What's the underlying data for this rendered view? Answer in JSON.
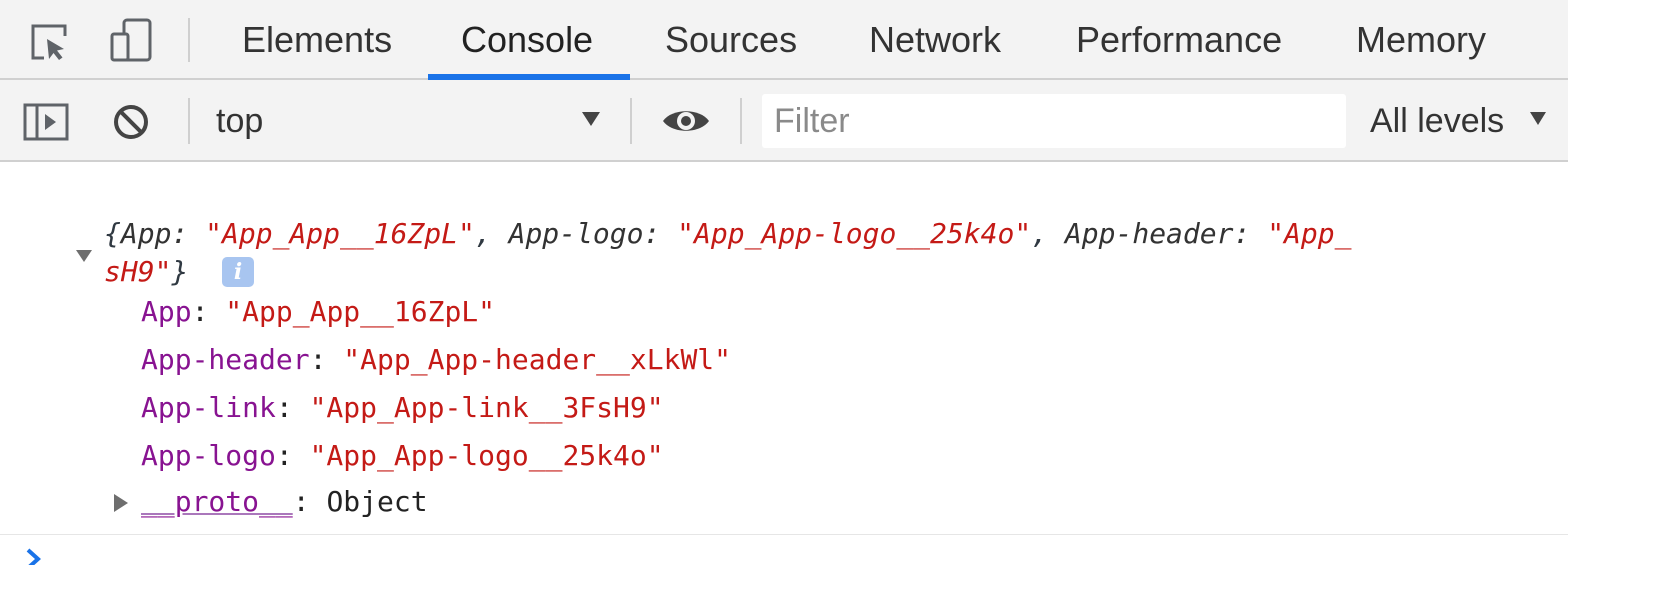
{
  "tabs": {
    "items": [
      {
        "label": "Elements"
      },
      {
        "label": "Console"
      },
      {
        "label": "Sources"
      },
      {
        "label": "Network"
      },
      {
        "label": "Performance"
      },
      {
        "label": "Memory"
      }
    ],
    "active": "Console"
  },
  "toolbar": {
    "context": "top",
    "filter_placeholder": "Filter",
    "levels_label": "All levels"
  },
  "console": {
    "summary": {
      "open_brace": "{",
      "k1": "App: ",
      "v1": "\"App_App__16ZpL\"",
      "sep1": ", ",
      "k2": "App-logo: ",
      "v2": "\"App_App-logo__25k4o\"",
      "sep2": ", ",
      "k3": "App-header: ",
      "v3_start": "\"App_",
      "v3_end": "sH9\"",
      "close_brace": "}",
      "info_label": "i"
    },
    "properties": [
      {
        "key": "App",
        "value": "\"App_App__16ZpL\""
      },
      {
        "key": "App-header",
        "value": "\"App_App-header__xLkWl\""
      },
      {
        "key": "App-link",
        "value": "\"App_App-link__3FsH9\""
      },
      {
        "key": "App-logo",
        "value": "\"App_App-logo__25k4o\""
      }
    ],
    "proto": {
      "key": "__proto__",
      "value": "Object"
    },
    "colon": ": "
  },
  "colors": {
    "tab_accent": "#1a73e8",
    "string_value": "#c41a16",
    "property_key": "#881391",
    "prompt": "#1a73e8"
  },
  "icons": [
    "inspect-element-icon",
    "device-toolbar-icon",
    "sidebar-toggle-icon",
    "clear-console-icon",
    "eye-icon",
    "console-prompt-icon"
  ]
}
